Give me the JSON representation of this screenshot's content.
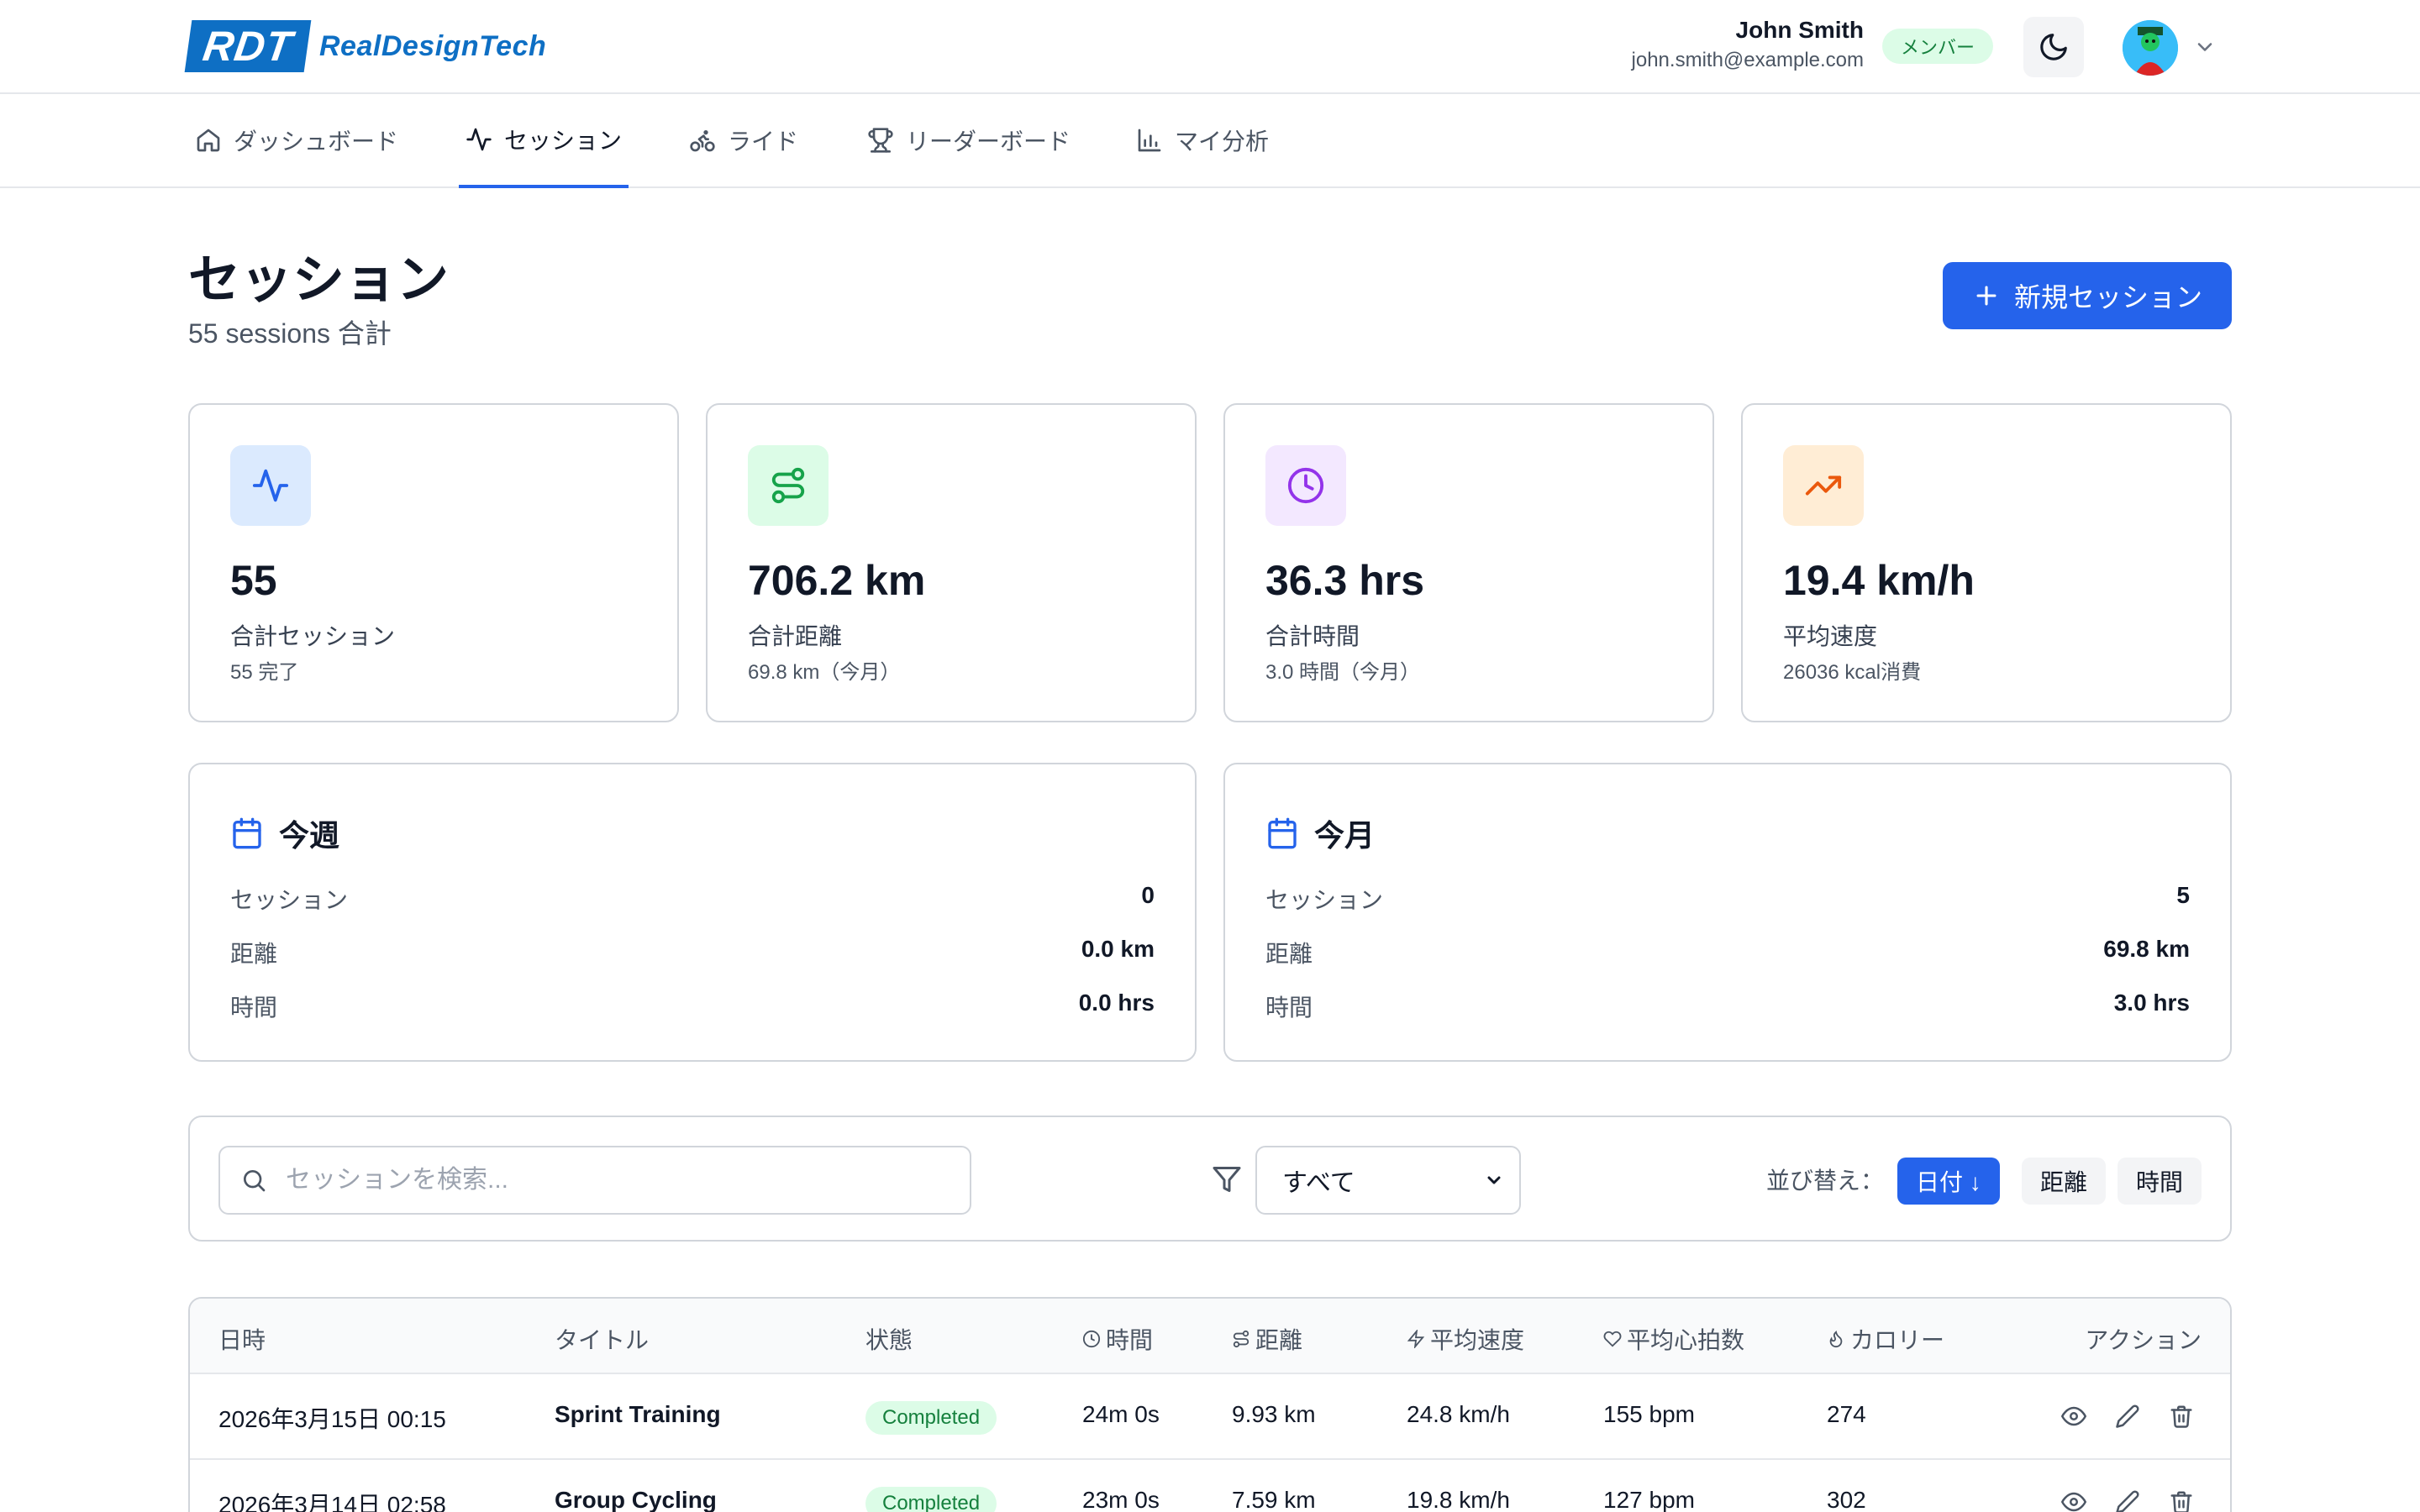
{
  "brand": {
    "logo_mark": "RDT",
    "logo_text": "RealDesignTech",
    "color": "#0e6fc4"
  },
  "header": {
    "user_name": "John Smith",
    "user_email": "john.smith@example.com",
    "role": "メンバー",
    "theme_icon": "moon-icon",
    "avatar_icon": "avatar"
  },
  "nav": {
    "items": [
      {
        "label": "ダッシュボード",
        "icon": "home-icon"
      },
      {
        "label": "セッション",
        "icon": "activity-icon",
        "active": true
      },
      {
        "label": "ライド",
        "icon": "bike-icon"
      },
      {
        "label": "リーダーボード",
        "icon": "trophy-icon"
      },
      {
        "label": "マイ分析",
        "icon": "bar-chart-icon"
      }
    ]
  },
  "page": {
    "title": "セッション",
    "subtitle": "55 sessions 合計",
    "new_button": "新規セッション"
  },
  "stats": [
    {
      "value": "55",
      "label": "合計セッション",
      "note": "55 完了",
      "icon": "activity-icon",
      "color": "#2563eb",
      "bg": "#dbeafe"
    },
    {
      "value": "706.2 km",
      "label": "合計距離",
      "note": "69.8 km（今月）",
      "icon": "route-icon",
      "color": "#16a34a",
      "bg": "#dcfce7"
    },
    {
      "value": "36.3 hrs",
      "label": "合計時間",
      "note": "3.0 時間（今月）",
      "icon": "clock-icon",
      "color": "#9333ea",
      "bg": "#f3e8ff"
    },
    {
      "value": "19.4 km/h",
      "label": "平均速度",
      "note": "26036 kcal消費",
      "icon": "trending-up-icon",
      "color": "#ea580c",
      "bg": "#ffedd5"
    }
  ],
  "week": {
    "title": "今週",
    "rows": [
      {
        "label": "セッション",
        "value": "0"
      },
      {
        "label": "距離",
        "value": "0.0 km"
      },
      {
        "label": "時間",
        "value": "0.0 hrs"
      }
    ]
  },
  "month": {
    "title": "今月",
    "rows": [
      {
        "label": "セッション",
        "value": "5"
      },
      {
        "label": "距離",
        "value": "69.8 km"
      },
      {
        "label": "時間",
        "value": "3.0 hrs"
      }
    ]
  },
  "filters": {
    "search_placeholder": "セッションを検索...",
    "status_selected": "すべて",
    "sort_label": "並び替え：",
    "sort_date": "日付 ↓",
    "sort_distance": "距離",
    "sort_time": "時間"
  },
  "table": {
    "headers": {
      "date": "日時",
      "title": "タイトル",
      "status": "状態",
      "duration": "時間",
      "distance": "距離",
      "avg_speed": "平均速度",
      "avg_hr": "平均心拍数",
      "calories": "カロリー",
      "actions": "アクション"
    },
    "rows": [
      {
        "date": "2026年3月15日 00:15",
        "title": "Sprint Training",
        "status": "Completed",
        "duration": "24m 0s",
        "distance": "9.93 km",
        "avg_speed": "24.8 km/h",
        "avg_hr": "155 bpm",
        "calories": "274"
      },
      {
        "date": "2026年3月14日 02:58",
        "title": "Group Cycling",
        "status": "Completed",
        "duration": "23m 0s",
        "distance": "7.59 km",
        "avg_speed": "19.8 km/h",
        "avg_hr": "127 bpm",
        "calories": "302"
      }
    ]
  }
}
